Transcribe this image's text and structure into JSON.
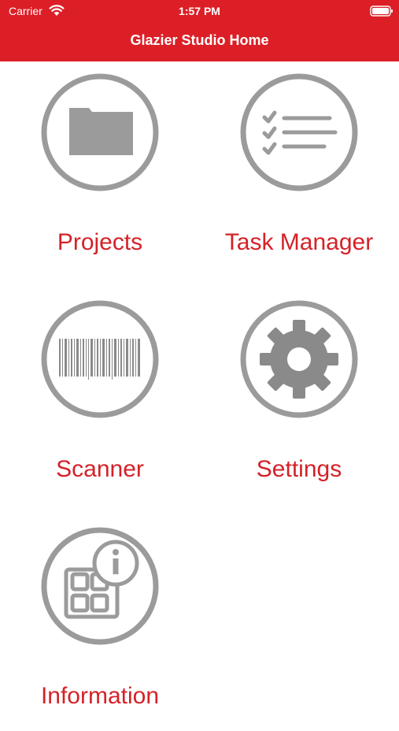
{
  "status_bar": {
    "carrier": "Carrier",
    "time": "1:57 PM"
  },
  "header": {
    "title": "Glazier Studio Home"
  },
  "colors": {
    "accent": "#dc1f26",
    "label": "#d42228",
    "icon_gray": "#9b9b9b"
  },
  "menu": {
    "projects": {
      "label": "Projects",
      "icon": "folder-icon"
    },
    "task_manager": {
      "label": "Task Manager",
      "icon": "checklist-icon"
    },
    "scanner": {
      "label": "Scanner",
      "icon": "barcode-icon"
    },
    "settings": {
      "label": "Settings",
      "icon": "gear-icon"
    },
    "information": {
      "label": "Information",
      "icon": "info-apps-icon"
    }
  }
}
